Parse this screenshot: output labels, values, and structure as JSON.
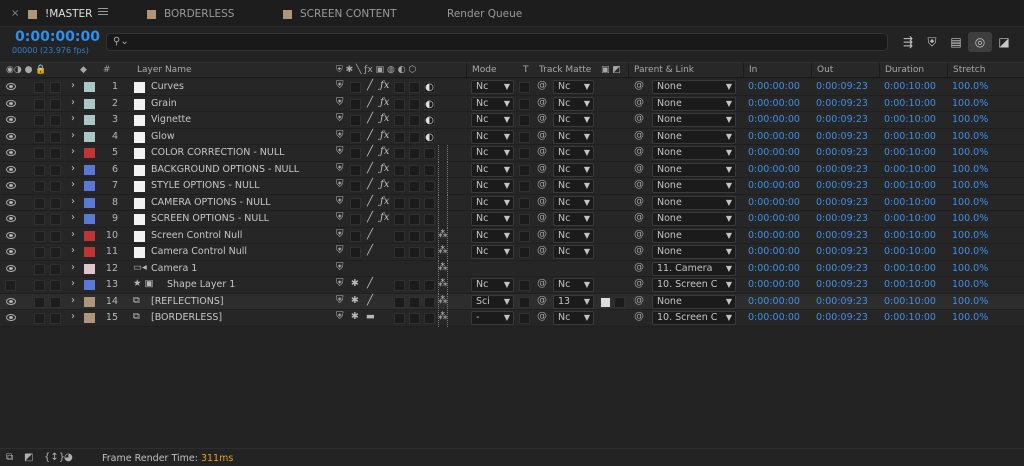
{
  "tabs": [
    {
      "label": "!MASTER",
      "color": "#b0957a",
      "active": true
    },
    {
      "label": "BORDERLESS",
      "color": "#b0957a",
      "active": false
    },
    {
      "label": "SCREEN CONTENT",
      "color": "#b0957a",
      "active": false
    },
    {
      "label": "Render Queue",
      "color": "",
      "active": false
    }
  ],
  "timecode": "0:00:00:00",
  "fps": "00000 (23.976 fps)",
  "search": {
    "placeholder": ""
  },
  "columns": {
    "layer_name": "Layer Name",
    "num": "#",
    "mode": "Mode",
    "t": "T",
    "track_matte": "Track Matte",
    "parent_link": "Parent & Link",
    "in": "In",
    "out": "Out",
    "duration": "Duration",
    "stretch": "Stretch"
  },
  "layers": [
    {
      "num": "1",
      "name": "Curves",
      "label_color": "#a8c8c4",
      "mode": "Nc",
      "matte": "Nc",
      "parent": "None",
      "in": "0:00:00:00",
      "out": "0:00:09:23",
      "duration": "0:00:10:00",
      "stretch": "100.0%",
      "adj": "◐"
    },
    {
      "num": "2",
      "name": "Grain",
      "label_color": "#a8c8c4",
      "mode": "Nc",
      "matte": "Nc",
      "parent": "None",
      "in": "0:00:00:00",
      "out": "0:00:09:23",
      "duration": "0:00:10:00",
      "stretch": "100.0%",
      "adj": "◐"
    },
    {
      "num": "3",
      "name": "Vignette",
      "label_color": "#a8c8c4",
      "mode": "Nc",
      "matte": "Nc",
      "parent": "None",
      "in": "0:00:00:00",
      "out": "0:00:09:23",
      "duration": "0:00:10:00",
      "stretch": "100.0%",
      "adj": "◐"
    },
    {
      "num": "4",
      "name": "Glow",
      "label_color": "#a8c8c4",
      "mode": "Nc",
      "matte": "Nc",
      "parent": "None",
      "in": "0:00:00:00",
      "out": "0:00:09:23",
      "duration": "0:00:10:00",
      "stretch": "100.0%",
      "adj": "◐"
    },
    {
      "num": "5",
      "name": "COLOR CORRECTION - NULL",
      "label_color": "#c03434",
      "mode": "Nc",
      "matte": "Nc",
      "parent": "None",
      "in": "0:00:00:00",
      "out": "0:00:09:23",
      "duration": "0:00:10:00",
      "stretch": "100.0%"
    },
    {
      "num": "6",
      "name": "BACKGROUND OPTIONS - NULL",
      "label_color": "#5a78d8",
      "mode": "Nc",
      "matte": "Nc",
      "parent": "None",
      "in": "0:00:00:00",
      "out": "0:00:09:23",
      "duration": "0:00:10:00",
      "stretch": "100.0%"
    },
    {
      "num": "7",
      "name": "STYLE OPTIONS - NULL",
      "label_color": "#5a78d8",
      "mode": "Nc",
      "matte": "Nc",
      "parent": "None",
      "in": "0:00:00:00",
      "out": "0:00:09:23",
      "duration": "0:00:10:00",
      "stretch": "100.0%"
    },
    {
      "num": "8",
      "name": "CAMERA OPTIONS - NULL",
      "label_color": "#5a78d8",
      "mode": "Nc",
      "matte": "Nc",
      "parent": "None",
      "in": "0:00:00:00",
      "out": "0:00:09:23",
      "duration": "0:00:10:00",
      "stretch": "100.0%"
    },
    {
      "num": "9",
      "name": "SCREEN OPTIONS - NULL",
      "label_color": "#5a78d8",
      "mode": "Nc",
      "matte": "Nc",
      "parent": "None",
      "in": "0:00:00:00",
      "out": "0:00:09:23",
      "duration": "0:00:10:00",
      "stretch": "100.0%"
    },
    {
      "num": "10",
      "name": "Screen Control Null",
      "label_color": "#c03434",
      "mode": "Nc",
      "matte": "Nc",
      "parent": "None",
      "in": "0:00:00:00",
      "out": "0:00:09:23",
      "duration": "0:00:10:00",
      "stretch": "100.0%"
    },
    {
      "num": "11",
      "name": "Camera Control Null",
      "label_color": "#c03434",
      "mode": "Nc",
      "matte": "Nc",
      "parent": "None",
      "in": "0:00:00:00",
      "out": "0:00:09:23",
      "duration": "0:00:10:00",
      "stretch": "100.0%"
    },
    {
      "num": "12",
      "name": "Camera 1",
      "label_color": "#e0c6cc",
      "mode": "",
      "matte": "",
      "parent": "11. Camera",
      "in": "0:00:00:00",
      "out": "0:00:09:23",
      "duration": "0:00:10:00",
      "stretch": "100.0%"
    },
    {
      "num": "13",
      "name": "Shape Layer 1",
      "label_color": "#5a78d8",
      "mode": "Nc",
      "matte": "Nc",
      "parent": "10. Screen C",
      "in": "0:00:00:00",
      "out": "0:00:09:23",
      "duration": "0:00:10:00",
      "stretch": "100.0%"
    },
    {
      "num": "14",
      "name": "[REFLECTIONS]",
      "label_color": "#b0957a",
      "mode": "Sci",
      "matte": "13",
      "parent": "None",
      "in": "0:00:00:00",
      "out": "0:00:09:23",
      "duration": "0:00:10:00",
      "stretch": "100.0%"
    },
    {
      "num": "15",
      "name": "[BORDERLESS]",
      "label_color": "#b0957a",
      "mode": "-",
      "matte": "Nc",
      "parent": "10. Screen C",
      "in": "0:00:00:00",
      "out": "0:00:09:23",
      "duration": "0:00:10:00",
      "stretch": "100.0%"
    }
  ],
  "footer": {
    "label": "Frame Render Time:",
    "value": "311ms"
  }
}
